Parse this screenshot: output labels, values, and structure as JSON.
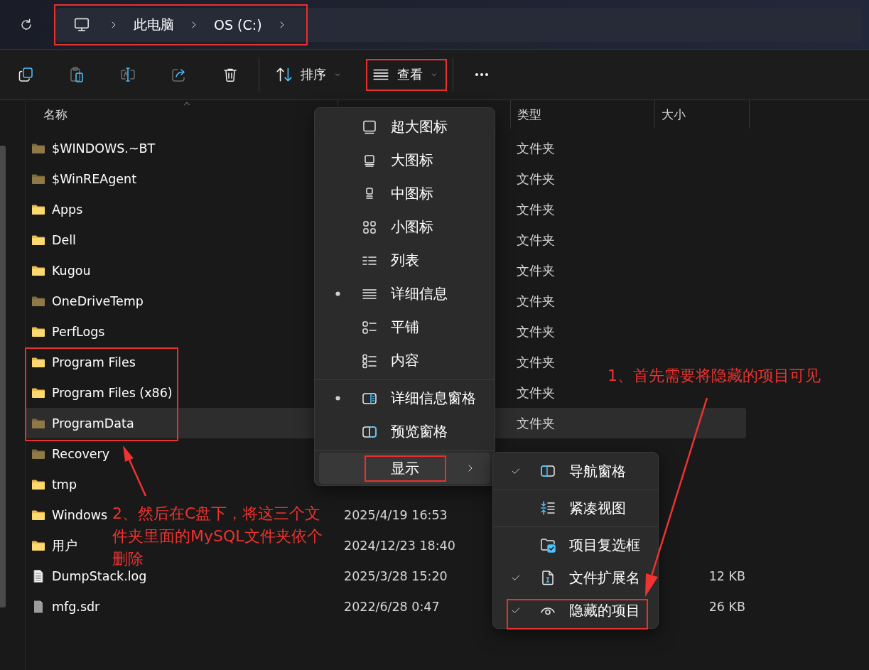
{
  "address_bar": {
    "crumbs": [
      "此电脑",
      "OS (C:)"
    ]
  },
  "toolbar": {
    "buttons": [
      {
        "kind": "copy",
        "disabled": false
      },
      {
        "kind": "paste",
        "disabled": true
      },
      {
        "kind": "rename",
        "disabled": true
      },
      {
        "kind": "share",
        "disabled": true
      },
      {
        "kind": "delete",
        "disabled": false
      }
    ],
    "sort": {
      "label": "排序"
    },
    "view": {
      "label": "查看"
    }
  },
  "file_list": {
    "headers": {
      "name": "名称",
      "type": "类型",
      "size": "大小"
    },
    "rows": [
      {
        "name": "$WINDOWS.~BT",
        "kind": "folder",
        "hidden": true,
        "type": "文件夹",
        "selected": false
      },
      {
        "name": "$WinREAgent",
        "kind": "folder",
        "hidden": true,
        "type": "文件夹",
        "selected": false
      },
      {
        "name": "Apps",
        "kind": "folder",
        "hidden": false,
        "type": "文件夹",
        "selected": false
      },
      {
        "name": "Dell",
        "kind": "folder",
        "hidden": false,
        "type": "文件夹",
        "selected": false
      },
      {
        "name": "Kugou",
        "kind": "folder",
        "hidden": false,
        "type": "文件夹",
        "selected": false
      },
      {
        "name": "OneDriveTemp",
        "kind": "folder",
        "hidden": true,
        "type": "文件夹",
        "selected": false
      },
      {
        "name": "PerfLogs",
        "kind": "folder",
        "hidden": false,
        "type": "文件夹",
        "selected": false
      },
      {
        "name": "Program Files",
        "kind": "folder",
        "hidden": false,
        "type": "文件夹",
        "selected": false
      },
      {
        "name": "Program Files (x86)",
        "kind": "folder",
        "hidden": false,
        "type": "文件夹",
        "selected": false
      },
      {
        "name": "ProgramData",
        "kind": "folder",
        "hidden": true,
        "type": "文件夹",
        "selected": true
      },
      {
        "name": "Recovery",
        "kind": "folder",
        "hidden": true,
        "selected": false
      },
      {
        "name": "tmp",
        "kind": "folder",
        "hidden": false,
        "selected": false
      },
      {
        "name": "Windows",
        "kind": "folder",
        "hidden": false,
        "date": "2025/4/19 16:53",
        "selected": false
      },
      {
        "name": "用户",
        "kind": "folder",
        "hidden": false,
        "date": "2024/12/23 18:40",
        "selected": false
      },
      {
        "name": "DumpStack.log",
        "kind": "text-file",
        "date": "2025/3/28 15:20",
        "size": "12 KB",
        "selected": false
      },
      {
        "name": "mfg.sdr",
        "kind": "file",
        "date": "2022/6/28 0:47",
        "size": "26 KB",
        "selected": false
      }
    ]
  },
  "view_menu": {
    "groups": [
      [
        {
          "label": "超大图标",
          "kind": "option",
          "selected": false
        },
        {
          "label": "大图标",
          "kind": "option",
          "selected": false
        },
        {
          "label": "中图标",
          "kind": "option",
          "selected": false
        },
        {
          "label": "小图标",
          "kind": "option",
          "selected": false
        },
        {
          "label": "列表",
          "kind": "option",
          "selected": false
        },
        {
          "label": "详细信息",
          "kind": "option",
          "selected": true
        },
        {
          "label": "平铺",
          "kind": "option",
          "selected": false
        },
        {
          "label": "内容",
          "kind": "option",
          "selected": false
        }
      ],
      [
        {
          "label": "详细信息窗格",
          "kind": "option",
          "selected": true
        },
        {
          "label": "预览窗格",
          "kind": "option",
          "selected": false
        }
      ],
      [
        {
          "label": "显示",
          "kind": "submenu",
          "hovered": true
        }
      ]
    ]
  },
  "show_menu": {
    "groups": [
      [
        {
          "label": "导航窗格",
          "checked": true
        }
      ],
      [
        {
          "label": "紧凑视图",
          "checked": false
        }
      ],
      [
        {
          "label": "项目复选框",
          "checked": false
        },
        {
          "label": "文件扩展名",
          "checked": true
        },
        {
          "label": "隐藏的项目",
          "checked": true
        }
      ]
    ]
  },
  "annotations": {
    "notes": [
      "1、首先需要将隐藏的项目可见",
      "2、然后在C盘下，将这三个文件夹里面的MySQL文件夹依个删除"
    ]
  }
}
